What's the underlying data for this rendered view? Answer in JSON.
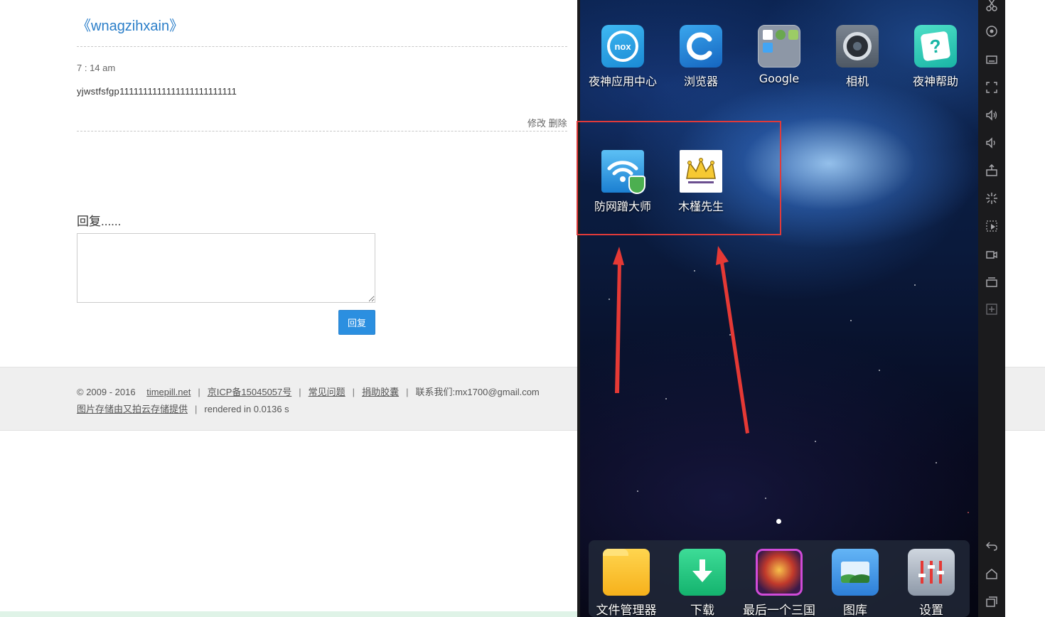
{
  "post": {
    "title": "《wnagzihxain》",
    "time": "7 : 14 am",
    "body": "yjwstfsfgp1111111111111111111111111",
    "edit_label": "修改",
    "delete_label": "删除"
  },
  "reply": {
    "heading": "回复......",
    "button_label": "回复",
    "textarea_value": ""
  },
  "footer": {
    "copyright": "© 2009 - 2016",
    "site_link": "timepill.net",
    "icp_link": "京ICP备15045057号",
    "faq_link": "常见问题",
    "donate_link": "捐助胶囊",
    "contact": "联系我们:mx1700@gmail.com",
    "storage_link": "图片存储由又拍云存储提供",
    "render_time": "rendered in 0.0136 s"
  },
  "emulator": {
    "home_apps": [
      {
        "label": "夜神应用中心",
        "icon": "nox-app-center-icon"
      },
      {
        "label": "浏览器",
        "icon": "browser-icon"
      },
      {
        "label": "Google",
        "icon": "google-folder-icon"
      },
      {
        "label": "相机",
        "icon": "camera-icon"
      },
      {
        "label": "夜神帮助",
        "icon": "nox-help-icon"
      }
    ],
    "highlighted_apps": [
      {
        "label": "防网蹭大师",
        "icon": "wifi-shield-icon"
      },
      {
        "label": "木槿先生",
        "icon": "crown-icon"
      }
    ],
    "dock_apps": [
      {
        "label": "文件管理器",
        "icon": "folder-icon"
      },
      {
        "label": "下载",
        "icon": "download-icon"
      },
      {
        "label": "最后一个三国",
        "icon": "game-icon"
      },
      {
        "label": "图库",
        "icon": "gallery-icon"
      },
      {
        "label": "设置",
        "icon": "settings-icon"
      }
    ],
    "nox_logo_text": "nox",
    "colors": {
      "highlight": "#e03a3a",
      "arrow": "#e53935",
      "link": "#2a7ec9",
      "reply_button": "#2b8fe0"
    }
  },
  "sidebar_icons": [
    "scissors-icon",
    "location-icon",
    "keyboard-icon",
    "fullscreen-icon",
    "volume-up-icon",
    "volume-down-icon",
    "apk-install-icon",
    "shake-icon",
    "macro-icon",
    "record-icon",
    "multi-instance-icon",
    "add-icon",
    "back-icon",
    "home-icon",
    "recent-apps-icon"
  ]
}
